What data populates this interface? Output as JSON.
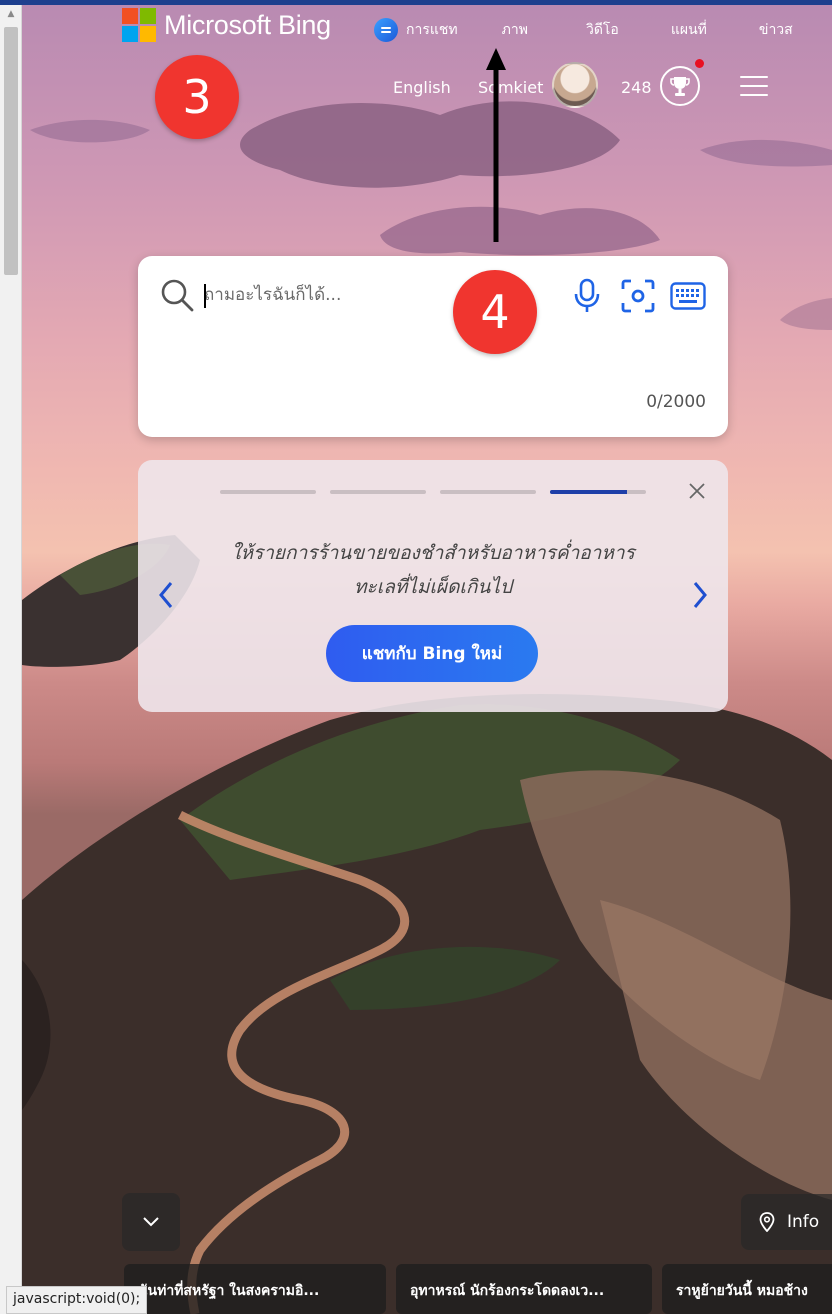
{
  "header": {
    "logo_text": "Microsoft Bing",
    "nav": [
      "การแชท",
      "ภาพ",
      "วิดีโอ",
      "แผนที่",
      "ข่าวส"
    ],
    "language": "English",
    "user_name": "Somkiet",
    "points": "248"
  },
  "annotations": {
    "badge3": "3",
    "badge4": "4"
  },
  "search": {
    "placeholder": "ถามอะไรฉันก็ได้...",
    "counter": "0/2000"
  },
  "suggestion": {
    "text_line1": "ให้รายการร้านขายของชำสำหรับอาหารค่ำอาหาร",
    "text_line2": "ทะเลที่ไม่เผ็ดเกินไป",
    "button": "แชทกับ Bing ใหม่",
    "progress": [
      1,
      1,
      1,
      0.8
    ]
  },
  "bottom": {
    "info_label": "Info",
    "news": [
      "ฉันท่าที่สหรัฐา ในสงครามอิ...",
      "อุทาหรณ์ นักร้องกระโดดลงเว...",
      "ราหูย้ายวันนี้ หมอช้าง"
    ]
  },
  "status_text": "javascript:void(0);",
  "colors": {
    "accent": "#2f5cf0",
    "badge": "#f0352f",
    "notify": "#e81123"
  }
}
